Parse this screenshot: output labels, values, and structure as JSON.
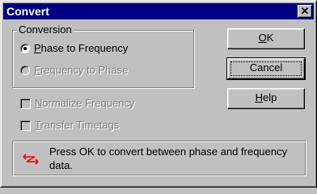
{
  "window": {
    "title": "Convert",
    "close_glyph": "✕"
  },
  "conversion": {
    "legend": "Conversion",
    "options": [
      {
        "mnemonic": "P",
        "rest": "hase to Frequency",
        "selected": true,
        "enabled": true
      },
      {
        "mnemonic": "F",
        "rest": "requency to Phase",
        "selected": false,
        "enabled": false
      }
    ]
  },
  "checkboxes": [
    {
      "mnemonic": "N",
      "rest": "ormalize Frequency",
      "checked": false,
      "enabled": false
    },
    {
      "mnemonic": "T",
      "rest": "ransfer Timetags",
      "checked": false,
      "enabled": false
    }
  ],
  "buttons": {
    "ok": {
      "mnemonic": "O",
      "rest": "K"
    },
    "cancel": {
      "mnemonic": "",
      "rest": "Cancel"
    },
    "help": {
      "mnemonic": "H",
      "rest": "elp"
    }
  },
  "info": {
    "icon": "convert-arrows-icon",
    "icon_color": "#ff0000",
    "message": "Press OK to convert between phase and frequency data."
  },
  "colors": {
    "title_bar": "#000080",
    "face": "#c0c0c0",
    "disabled_text": "#808080"
  }
}
